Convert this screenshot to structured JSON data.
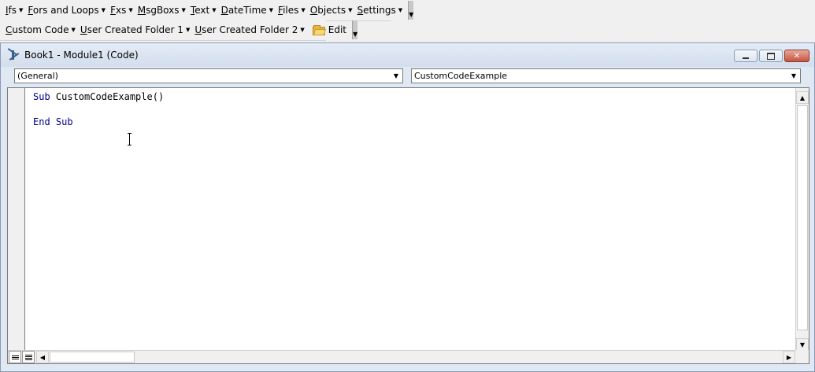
{
  "toolbar1": {
    "items": [
      {
        "label": "Ifs"
      },
      {
        "label": "Fors and Loops"
      },
      {
        "label": "Fxs"
      },
      {
        "label": "MsgBoxs"
      },
      {
        "label": "Text"
      },
      {
        "label": "DateTime"
      },
      {
        "label": "Files"
      },
      {
        "label": "Objects"
      },
      {
        "label": "Settings"
      }
    ]
  },
  "toolbar2": {
    "items": [
      {
        "label": "Custom Code"
      },
      {
        "label": "User Created Folder 1"
      },
      {
        "label": "User Created Folder 2"
      }
    ],
    "edit_label": "Edit"
  },
  "window": {
    "title": "Book1 - Module1 (Code)",
    "object_combo": "(General)",
    "procedure_combo": "CustomCodeExample"
  },
  "code": {
    "line1_kw": "Sub",
    "line1_rest": " CustomCodeExample()",
    "line3": "End Sub"
  },
  "colors": {
    "keyword": "#00008b",
    "title_bar": "#d3deec"
  }
}
